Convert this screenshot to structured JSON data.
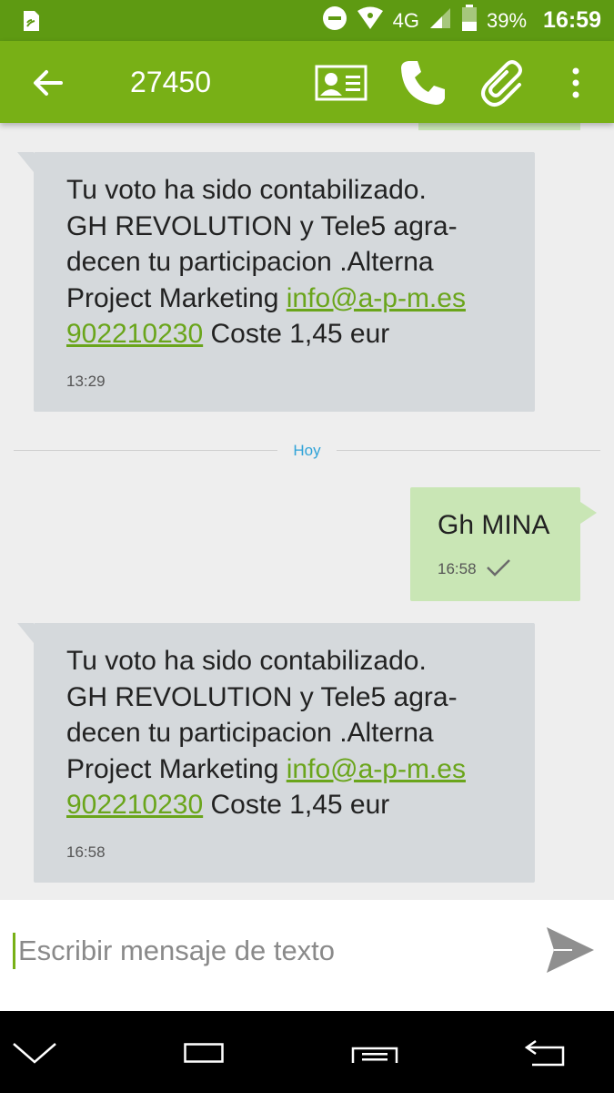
{
  "status_bar": {
    "network": "4G",
    "battery_percent": "39%",
    "battery_level": 0.39,
    "time": "16:59"
  },
  "header": {
    "title": "27450",
    "icons": [
      "back-arrow-icon",
      "contact-card-icon",
      "phone-icon",
      "attachment-icon",
      "overflow-menu-icon"
    ]
  },
  "messages": [
    {
      "direction": "incoming",
      "text_lines": [
        "Tu voto ha sido contabilizado.",
        "GH REVOLUTION y Tele5 agra-",
        "decen tu participacion .Alterna",
        "Project Marketing "
      ],
      "email_link": "info@a-p-m.es",
      "phone_link": "902210230",
      "tail": " Coste 1,45 eur",
      "time": "13:29"
    },
    {
      "direction": "outgoing",
      "text": "Gh MINA",
      "time": "16:58"
    },
    {
      "direction": "incoming",
      "text_lines": [
        "Tu voto ha sido contabilizado.",
        "GH REVOLUTION y Tele5 agra-",
        "decen tu participacion .Alterna",
        "Project Marketing "
      ],
      "email_link": "info@a-p-m.es",
      "phone_link": "902210230",
      "tail": " Coste 1,45 eur",
      "time": "16:58"
    }
  ],
  "date_divider": "Hoy",
  "compose": {
    "placeholder": "Escribir mensaje de texto"
  },
  "colors": {
    "status_bar": "#5e9a12",
    "app_bar": "#78b016",
    "incoming_bubble": "#d5d9dc",
    "outgoing_bubble": "#c9e6b5",
    "link": "#6aa51b",
    "divider_label": "#2fa3d8"
  }
}
